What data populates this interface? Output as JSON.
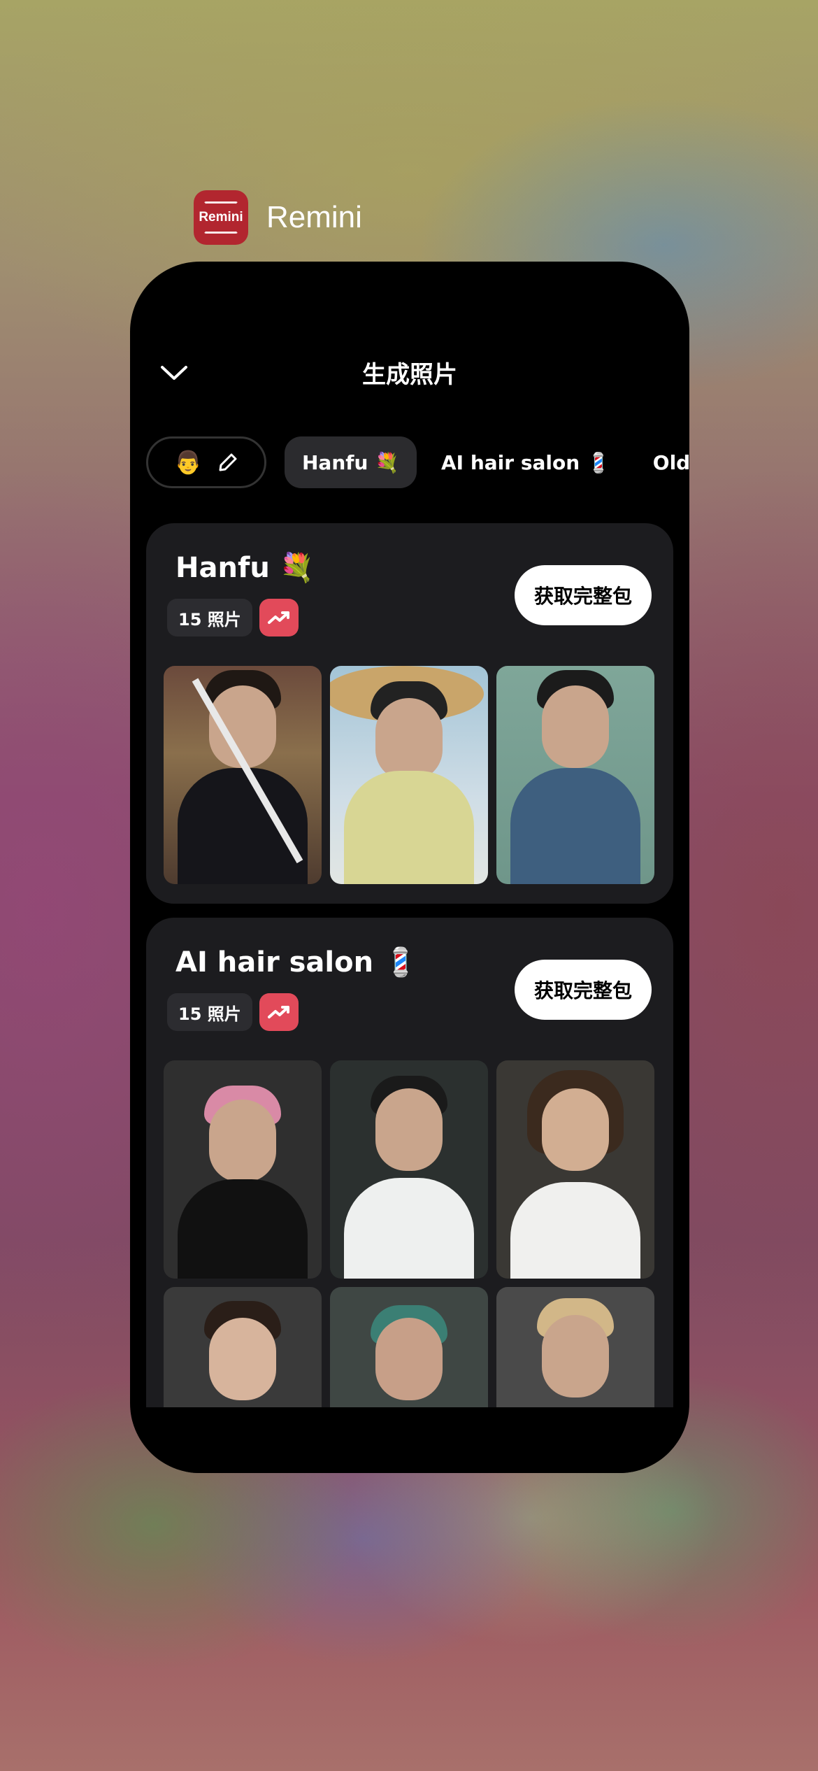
{
  "app_switcher": {
    "app_name": "Remini",
    "icon_text": "Remini"
  },
  "header": {
    "title": "生成照片",
    "back_icon": "chevron-down-icon"
  },
  "tabs": {
    "edit_avatar": "👨",
    "edit_icon": "pencil-icon",
    "items": [
      {
        "label": "Hanfu 💐",
        "active": true
      },
      {
        "label": "AI hair salon 💈",
        "active": false
      },
      {
        "label": "Old money 💰",
        "active": false
      }
    ]
  },
  "packs": [
    {
      "title": "Hanfu 💐",
      "count": "15 照片",
      "trend_icon": "trending-up-icon",
      "button": "获取完整包"
    },
    {
      "title": "AI hair salon 💈",
      "count": "15 照片",
      "trend_icon": "trending-up-icon",
      "button": "获取完整包"
    }
  ],
  "colors": {
    "accent": "#e24a5a",
    "card": "#1c1c1f",
    "brand": "#b2262f"
  }
}
